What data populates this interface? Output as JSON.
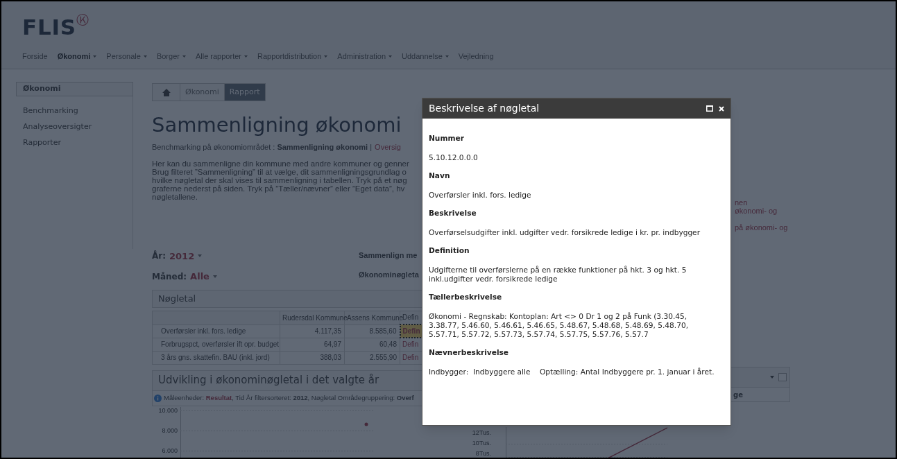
{
  "logo": {
    "text": "FLIS",
    "mark": "Ⓚ"
  },
  "nav": [
    {
      "label": "Forside",
      "selected": false,
      "dropdown": false
    },
    {
      "label": "Økonomi",
      "selected": true,
      "dropdown": true
    },
    {
      "label": "Personale",
      "selected": false,
      "dropdown": true
    },
    {
      "label": "Borger",
      "selected": false,
      "dropdown": true
    },
    {
      "label": "Alle rapporter",
      "selected": false,
      "dropdown": true
    },
    {
      "label": "Rapportdistribution",
      "selected": false,
      "dropdown": true
    },
    {
      "label": "Administration",
      "selected": false,
      "dropdown": true
    },
    {
      "label": "Uddannelse",
      "selected": false,
      "dropdown": true
    },
    {
      "label": "Vejledning",
      "selected": false,
      "dropdown": false
    }
  ],
  "sidebar": {
    "title": "Økonomi",
    "items": [
      "Benchmarking",
      "Analyseoversigter",
      "Rapporter"
    ]
  },
  "breadcrumb": [
    {
      "label": "Økonomi",
      "selected": false
    },
    {
      "label": "Rapport",
      "selected": true
    }
  ],
  "page_title": "Sammenligning økonomi",
  "subtitle": "Benchmarking på økonomiområdet : **Sammenligning økonomi** |",
  "subtitle_link": "Oversig",
  "intro_lines": [
    "Her kan du sammenligne din kommune med andre kommuner og genner",
    "Brug filteret ”Sammenligning” til at vælge, dit sammenligningsgrundlag o",
    "hvilke nøgletal der skal vises til sammenligning i tabellen. Tryk på et nøg",
    "graferne nederst på siden. Tryk på ”Tæller/nævner” eller ”Eget data”, hv",
    "nøgletallene."
  ],
  "right_fragments": [
    [
      "nen",
      "økonomi- og"
    ],
    [
      "på økonomi- og"
    ]
  ],
  "filters": [
    {
      "label": "År:",
      "value": "2012"
    },
    {
      "label": "Måned:",
      "value": "Alle"
    }
  ],
  "filters_right": [
    "Sammenlign me",
    "Økonominøgleta"
  ],
  "key_figures": {
    "title": "Nøgletal",
    "columns": [
      "Rudersdal Kommune",
      "Assens Kommune",
      "Defin"
    ],
    "rows": [
      {
        "name": "Overførsler inkl. fors. ledige",
        "values": [
          "4.117,35",
          "8.585,60"
        ],
        "link": "Defin",
        "selected": true
      },
      {
        "name": "Forbrugspct, overførsler ift opr. budget",
        "values": [
          "64,97",
          "60,48"
        ],
        "link": "Defin",
        "selected": false
      },
      {
        "name": "3 års gns. skattefin. BAU (inkl. jord)",
        "values": [
          "388,03",
          "2.555,90"
        ],
        "link": "Defin",
        "selected": false
      }
    ]
  },
  "development": {
    "title": "Udvikling i økonominøgletal i det valgte år",
    "info": [
      {
        "kind": "plain",
        "text": "Måleenheder: "
      },
      {
        "kind": "accent",
        "text": "Resultat"
      },
      {
        "kind": "plain",
        "text": ", Tid År filtersorteret: "
      },
      {
        "kind": "bold",
        "text": "2012"
      },
      {
        "kind": "plain",
        "text": ", Nøgletal Områdegruppering: "
      },
      {
        "kind": "bold",
        "text": "Overf"
      }
    ],
    "info_right": "ge",
    "left_axis_labels": [
      "10.000",
      "8.000",
      "6.000"
    ],
    "right_axis_labels": [
      "12Tus.",
      "10Tus.",
      "8Tus."
    ]
  },
  "dialog": {
    "title": "Beskrivelse af nøgletal",
    "sections": [
      {
        "heading": "Nummer",
        "text": "5.10.12.0.0.0"
      },
      {
        "heading": "Navn",
        "text": "Overførsler inkl. fors. ledige"
      },
      {
        "heading": "Beskrivelse",
        "text": "Overførselsudgifter inkl. udgifter vedr. forsikrede ledige i kr. pr. indbygger"
      },
      {
        "heading": "Definition",
        "text": "Udgifterne til overførslerne på en række funktioner på hkt. 3 og hkt. 5 inkl.udgifter vedr. forsikrede ledige"
      },
      {
        "heading": "Tællerbeskrivelse",
        "text": "Økonomi - Regnskab: Kontoplan: Art <> 0 Dr 1 og 2 på Funk (3.30.45, 3.38.77, 5.46.60, 5.46.61, 5.46.65, 5.48.67, 5.48.68, 5.48.69, 5.48.70, 5.57.71, 5.57.72, 5.57.73, 5.57.74, 5.57.75, 5.57.76, 5.57.7"
      },
      {
        "heading": "Nævnerbeskrivelse",
        "text": "Indbygger:  Indbyggere alle    Optælling: Antal Indbyggere pr. 1. januar i året."
      }
    ]
  }
}
